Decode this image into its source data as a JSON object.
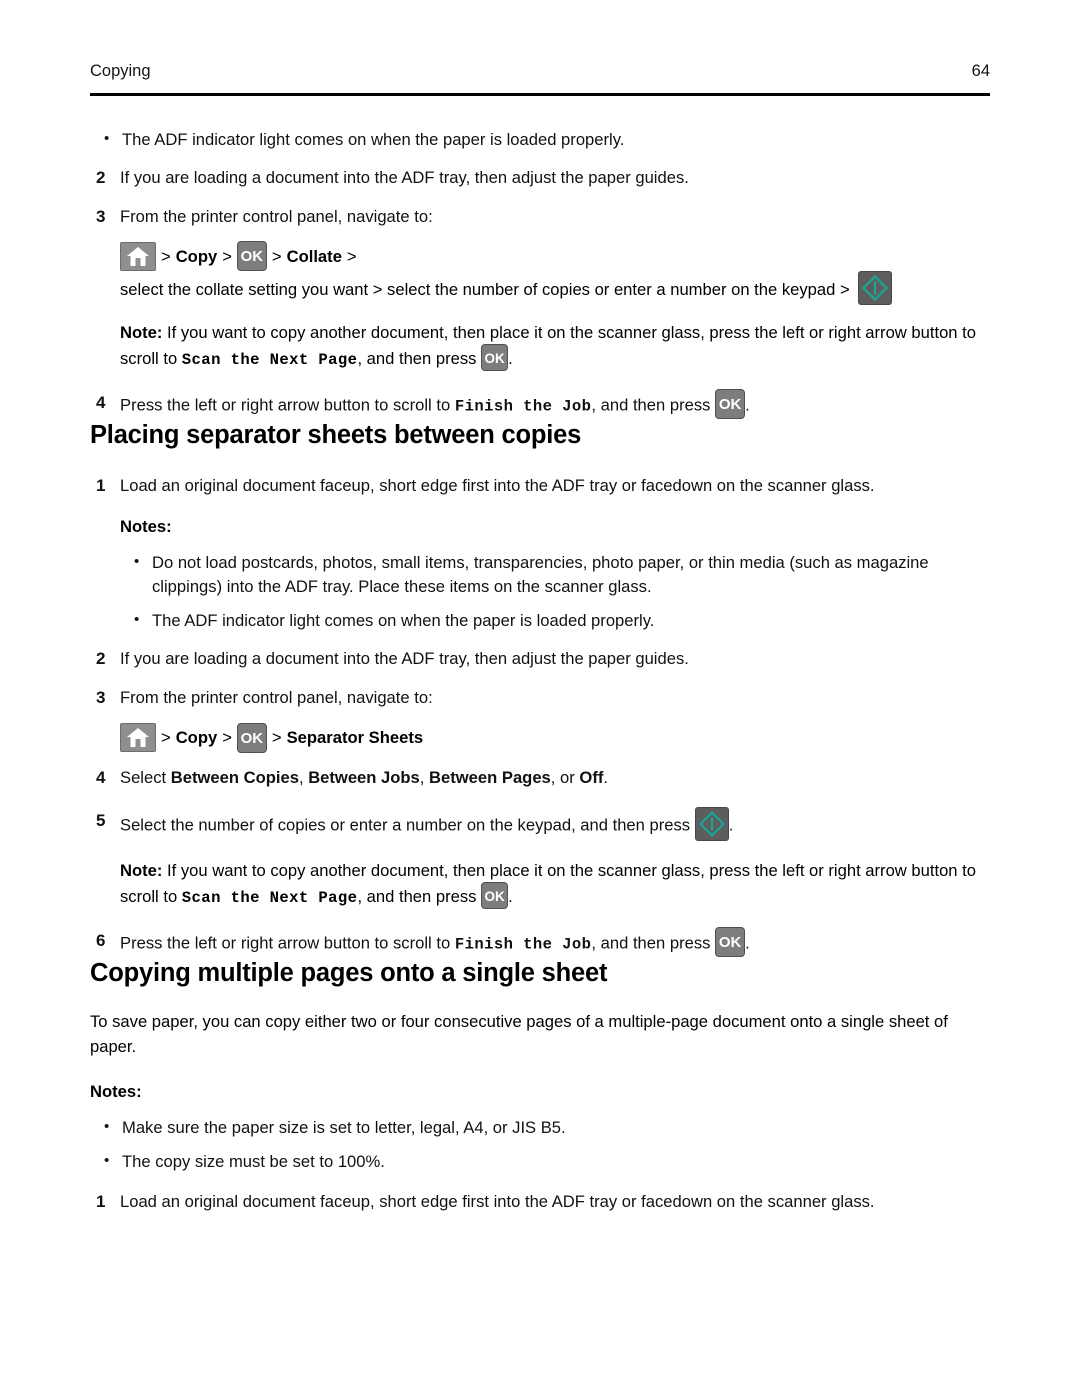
{
  "header": {
    "chapter": "Copying",
    "page_number": "64"
  },
  "icons": {
    "home": "home-icon",
    "ok": "OK",
    "start": "start-icon",
    "bullet": "•",
    "separator": ">"
  },
  "colors": {
    "button_gray": "#7d7d7d",
    "home_gray": "#8f8f8f",
    "start_dark": "#5d5d5d",
    "start_teal": "#17a697",
    "rule_black": "#000000"
  },
  "section_collate": {
    "bullet_1": "The ADF indicator light comes on when the paper is loaded properly.",
    "step_2": {
      "num": "2",
      "text": "If you are loading a document into the ADF tray, then adjust the paper guides."
    },
    "step_3": {
      "num": "3",
      "text": "From the printer control panel, navigate to:"
    },
    "nav": {
      "copy_label": "Copy",
      "collate_label": "Collate",
      "tail_text": "select the collate setting you want > select the number of copies or enter a number on the keypad >"
    },
    "note": {
      "label": "Note:",
      "text_1": "If you want to copy another document, then place it on the scanner glass, press the left or right arrow button to scroll to",
      "mono_1": "Scan the Next Page",
      "text_2": ", and then press",
      "text_3": "."
    },
    "step_4": {
      "num": "4",
      "text_1": "Press the left or right arrow button to scroll to",
      "mono": "Finish the Job",
      "text_2": ", and then press",
      "text_3": "."
    }
  },
  "section_separator": {
    "title": "Placing separator sheets between copies",
    "step_1": {
      "num": "1",
      "text": "Load an original document faceup, short edge first into the ADF tray or facedown on the scanner glass."
    },
    "notes_label": "Notes:",
    "bullets": [
      "Do not load postcards, photos, small items, transparencies, photo paper, or thin media (such as magazine clippings) into the ADF tray. Place these items on the scanner glass.",
      "The ADF indicator light comes on when the paper is loaded properly."
    ],
    "step_2": {
      "num": "2",
      "text": "If you are loading a document into the ADF tray, then adjust the paper guides."
    },
    "step_3": {
      "num": "3",
      "text": "From the printer control panel, navigate to:"
    },
    "nav": {
      "copy_label": "Copy",
      "separator_sheets_label": "Separator Sheets"
    },
    "step_4": {
      "num": "4",
      "prefix": "Select",
      "opt_1": "Between Copies",
      "opt_2": "Between Jobs",
      "opt_3": "Between Pages",
      "or_text": "or",
      "opt_4": "Off",
      "suffix": "."
    },
    "step_5": {
      "num": "5",
      "text": "Select the number of copies or enter a number on the keypad, and then press",
      "suffix": "."
    },
    "note": {
      "label": "Note:",
      "text_1": "If you want to copy another document, then place it on the scanner glass, press the left or right arrow button to scroll to",
      "mono_1": "Scan the Next Page",
      "text_2": ", and then press",
      "text_3": "."
    },
    "step_6": {
      "num": "6",
      "text_1": "Press the left or right arrow button to scroll to",
      "mono": "Finish the Job",
      "text_2": ", and then press",
      "text_3": "."
    }
  },
  "section_multiple": {
    "title": "Copying multiple pages onto a single sheet",
    "intro": "To save paper, you can copy either two or four consecutive pages of a multiple-page document onto a single sheet of paper.",
    "notes_label": "Notes:",
    "bullets": [
      "Make sure the paper size is set to letter, legal, A4, or JIS B5.",
      "The copy size must be set to 100%."
    ],
    "step_1": {
      "num": "1",
      "text": "Load an original document faceup, short edge first into the ADF tray or facedown on the scanner glass."
    }
  }
}
